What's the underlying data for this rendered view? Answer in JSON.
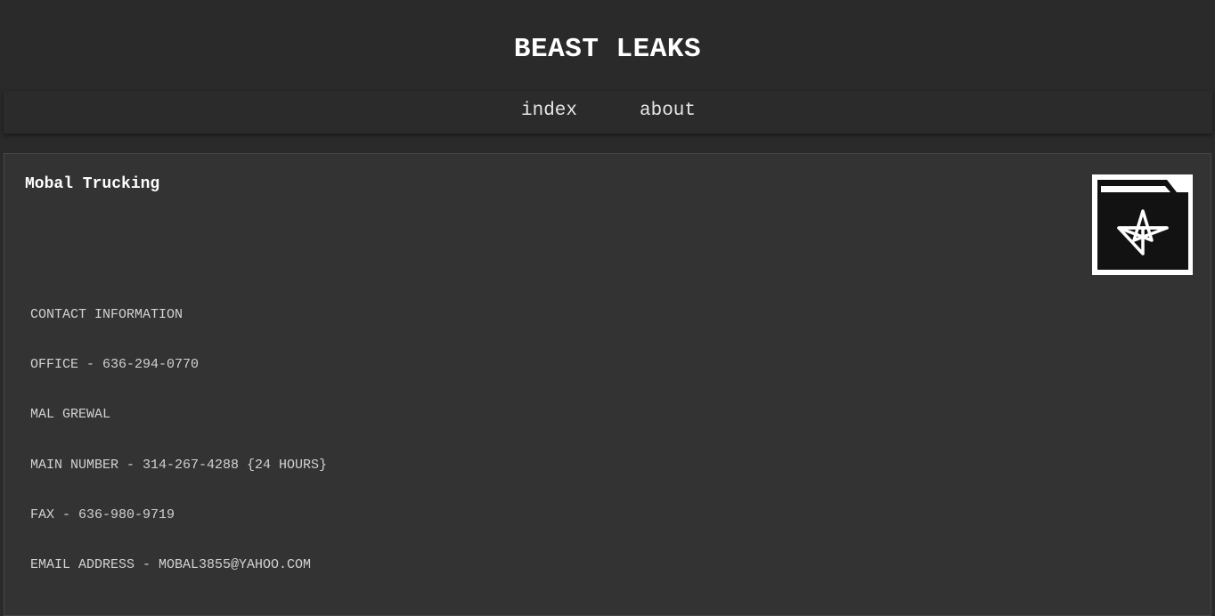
{
  "site": {
    "title": "BEAST LEAKS"
  },
  "nav": {
    "items": [
      {
        "label": "index"
      },
      {
        "label": "about"
      }
    ]
  },
  "post": {
    "title": "Mobal Trucking",
    "icon": "folder-pentagram-icon",
    "lines": [
      "CONTACT INFORMATION",
      "OFFICE - 636-294-0770",
      "MAL GREWAL",
      "MAIN NUMBER - 314-267-4288 {24 HOURS}",
      "FAX - 636-980-9719",
      "EMAIL ADDRESS - MOBAL3855@YAHOO.COM"
    ]
  },
  "colors": {
    "background": "#2a2a2a",
    "card": "#333333",
    "text": "#d2d2d2",
    "title": "#ffffff"
  }
}
